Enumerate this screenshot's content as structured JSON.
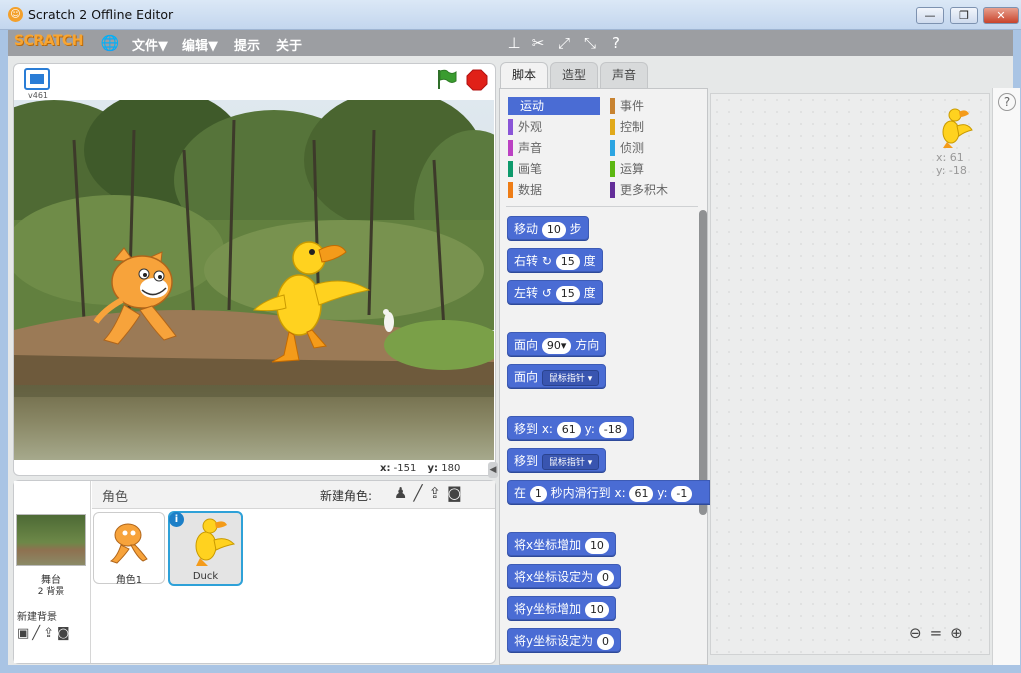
{
  "window": {
    "title": "Scratch 2 Offline Editor",
    "minimize": "—",
    "maximize": "❐",
    "close": "✕"
  },
  "menubar": {
    "logo": "SCRATCH",
    "file": "文件▼",
    "edit": "编辑▼",
    "tips": "提示",
    "about": "关于"
  },
  "stage": {
    "version": "v461",
    "coord_x_label": "x:",
    "coord_x": "-151",
    "coord_y_label": "y:",
    "coord_y": "180"
  },
  "tabs": [
    "脚本",
    "造型",
    "声音"
  ],
  "categories": {
    "left": [
      {
        "label": "运动",
        "color": "#4a6cd4"
      },
      {
        "label": "外观",
        "color": "#8a55d7"
      },
      {
        "label": "声音",
        "color": "#bb42c3"
      },
      {
        "label": "画笔",
        "color": "#0e9a6c"
      },
      {
        "label": "数据",
        "color": "#ee7d16"
      }
    ],
    "right": [
      {
        "label": "事件",
        "color": "#c88330"
      },
      {
        "label": "控制",
        "color": "#e1a91a"
      },
      {
        "label": "侦测",
        "color": "#2ca5e2"
      },
      {
        "label": "运算",
        "color": "#5cb712"
      },
      {
        "label": "更多积木",
        "color": "#632d99"
      }
    ]
  },
  "blocks": {
    "move": {
      "t1": "移动",
      "v": "10",
      "t2": "步"
    },
    "turn_right": {
      "t1": "右转",
      "icon": "↻",
      "v": "15",
      "t2": "度"
    },
    "turn_left": {
      "t1": "左转",
      "icon": "↺",
      "v": "15",
      "t2": "度"
    },
    "point_dir": {
      "t1": "面向",
      "v": "90▾",
      "t2": "方向"
    },
    "point_towards": {
      "t1": "面向",
      "dd": "鼠标指针 ▾"
    },
    "goto_xy": {
      "t1": "移到 x:",
      "x": "61",
      "t2": "y:",
      "y": "-18"
    },
    "goto": {
      "t1": "移到",
      "dd": "鼠标指针 ▾"
    },
    "glide": {
      "t1": "在",
      "v": "1",
      "t2": "秒内滑行到 x:",
      "x": "61",
      "t3": "y:",
      "y": "-1"
    },
    "change_x": {
      "t1": "将x坐标增加",
      "v": "10"
    },
    "set_x": {
      "t1": "将x坐标设定为",
      "v": "0"
    },
    "change_y": {
      "t1": "将y坐标增加",
      "v": "10"
    },
    "set_y": {
      "t1": "将y坐标设定为",
      "v": "0"
    }
  },
  "sprite_info": {
    "x_label": "x: 61",
    "y_label": "y: -18"
  },
  "sprites_panel": {
    "header": "角色",
    "new_sprite": "新建角色:",
    "stage_label": "舞台",
    "backdrops": "2 背景",
    "new_backdrop": "新建背景",
    "sprites": [
      {
        "name": "角色1",
        "selected": false
      },
      {
        "name": "Duck",
        "selected": true
      }
    ]
  },
  "colors": {
    "motion": "#4a6cd4",
    "selection": "#2ea1d8",
    "menubar": "#9c9ea2"
  }
}
